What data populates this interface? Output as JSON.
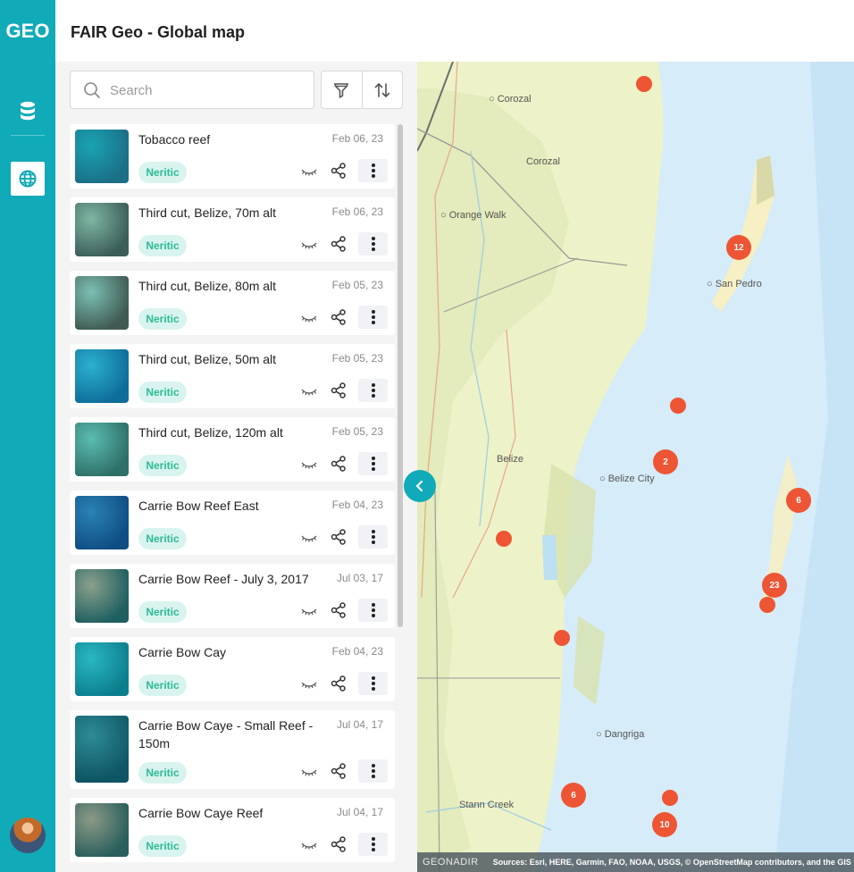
{
  "app": {
    "logo_text": "GEO",
    "title": "FAIR Geo - Global map"
  },
  "rail": {
    "items": [
      {
        "name": "datasets",
        "icon": "database-icon"
      },
      {
        "name": "global-map",
        "icon": "globe-icon",
        "active": true
      }
    ],
    "avatar": "user-avatar"
  },
  "search": {
    "placeholder": "Search",
    "value": ""
  },
  "toolbar": {
    "filter": "filter-icon",
    "sort": "sort-icon"
  },
  "items": [
    {
      "title": "Tobacco reef",
      "date": "Feb 06, 23",
      "tag": "Neritic",
      "thumb": [
        "#1b6f86",
        "#1aa3b3"
      ]
    },
    {
      "title": "Third cut, Belize, 70m alt",
      "date": "Feb 06, 23",
      "tag": "Neritic",
      "thumb": [
        "#3c5e58",
        "#7fb5a3"
      ]
    },
    {
      "title": "Third cut, Belize, 80m alt",
      "date": "Feb 05, 23",
      "tag": "Neritic",
      "thumb": [
        "#3f5a52",
        "#7cc0b4"
      ]
    },
    {
      "title": "Third cut, Belize, 50m alt",
      "date": "Feb 05, 23",
      "tag": "Neritic",
      "thumb": [
        "#0e6d9a",
        "#2bb0cf"
      ]
    },
    {
      "title": "Third cut, Belize, 120m alt",
      "date": "Feb 05, 23",
      "tag": "Neritic",
      "thumb": [
        "#2e7068",
        "#5bbcb0"
      ]
    },
    {
      "title": "Carrie Bow Reef East",
      "date": "Feb 04, 23",
      "tag": "Neritic",
      "thumb": [
        "#0f4e84",
        "#2a82b4"
      ]
    },
    {
      "title": "Carrie Bow Reef - July 3, 2017",
      "date": "Jul 03, 17",
      "tag": "Neritic",
      "thumb": [
        "#1e5f60",
        "#8aa08c"
      ]
    },
    {
      "title": "Carrie Bow Cay",
      "date": "Feb 04, 23",
      "tag": "Neritic",
      "thumb": [
        "#0c7f8e",
        "#2ab7c3"
      ]
    },
    {
      "title": "Carrie Bow Caye - Small Reef - 150m",
      "date": "Jul 04, 17",
      "tag": "Neritic",
      "thumb": [
        "#0f5565",
        "#2d8b95"
      ],
      "tall": true
    },
    {
      "title": "Carrie Bow Caye Reef",
      "date": "Jul 04, 17",
      "tag": "Neritic",
      "thumb": [
        "#2a5e5c",
        "#8b9a86"
      ]
    }
  ],
  "map": {
    "places": [
      {
        "name": "Corozal",
        "type": "town"
      },
      {
        "name": "Corozal",
        "type": "district"
      },
      {
        "name": "Orange Walk",
        "type": "town"
      },
      {
        "name": "San Pedro",
        "type": "town"
      },
      {
        "name": "Belize",
        "type": "district"
      },
      {
        "name": "Belize City",
        "type": "town"
      },
      {
        "name": "Dangriga",
        "type": "town"
      },
      {
        "name": "Stann Creek",
        "type": "district"
      }
    ],
    "clusters": [
      {
        "label": ""
      },
      {
        "label": "12"
      },
      {
        "label": ""
      },
      {
        "label": "2"
      },
      {
        "label": "6"
      },
      {
        "label": ""
      },
      {
        "label": "23"
      },
      {
        "label": ""
      },
      {
        "label": ""
      },
      {
        "label": "6"
      },
      {
        "label": ""
      },
      {
        "label": "10"
      }
    ],
    "marker_color": "#ee5535",
    "attribution_brand": "GEONADIR",
    "attribution_sources": "Sources: Esri, HERE, Garmin, FAO, NOAA, USGS, © OpenStreetMap contributors, and the GIS User Community"
  },
  "colors": {
    "brand": "#10aab8",
    "tag_bg": "#d9f4ee",
    "tag_text": "#2dbb94"
  }
}
